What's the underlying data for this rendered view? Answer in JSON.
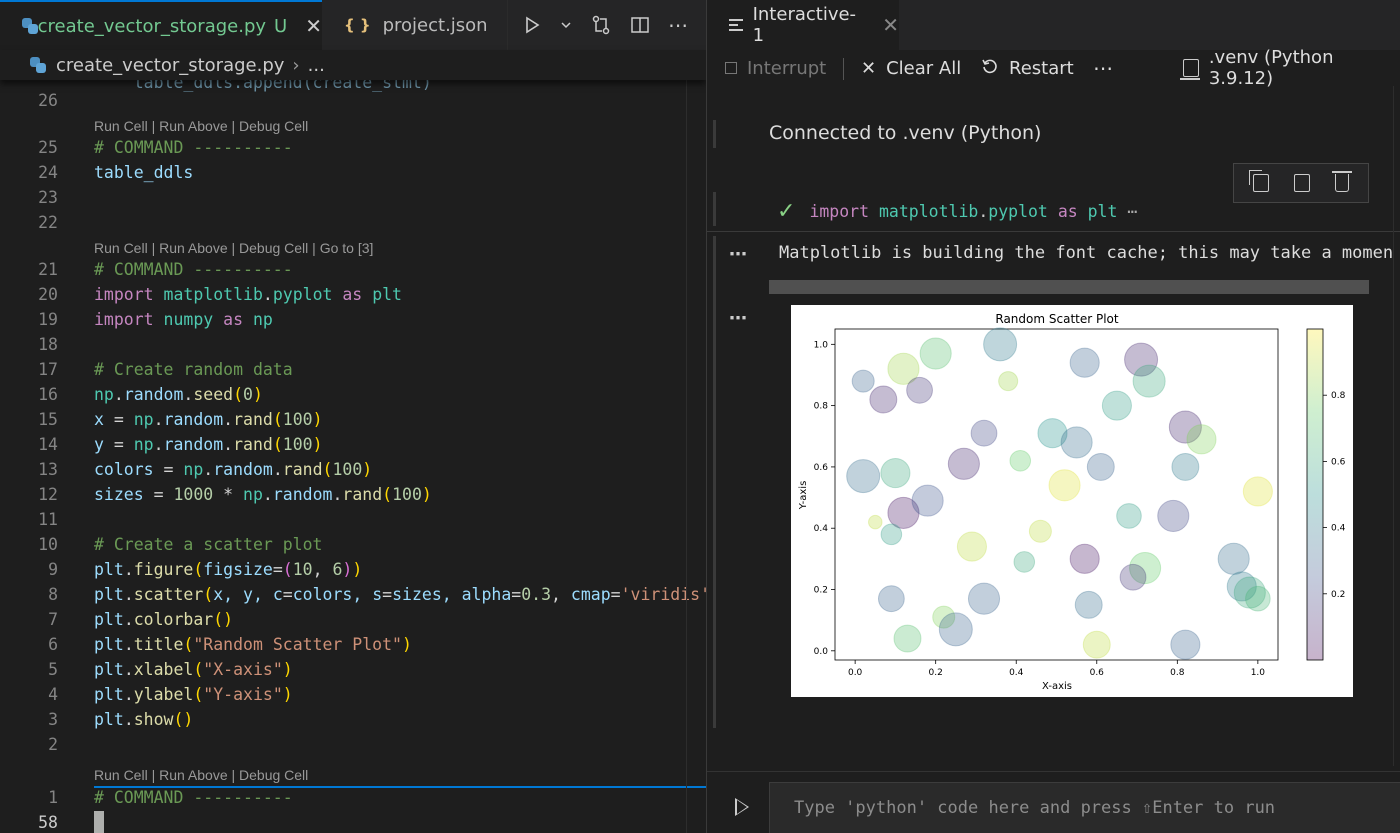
{
  "left_editor": {
    "tabs": [
      {
        "label": "create_vector_storage.py",
        "status": "U",
        "active": true
      },
      {
        "label": "project.json",
        "active": false
      }
    ],
    "breadcrumb": {
      "file": "create_vector_storage.py",
      "more": "..."
    },
    "codelens": {
      "cell_a": "Run Cell | Run Above | Debug Cell",
      "cell_b": "Run Cell | Run Above | Debug Cell | Go to [3]",
      "cell_c": "Run Cell | Run Above | Debug Cell"
    },
    "line_numbers": {
      "l26": "26",
      "l25": "25",
      "l24": "24",
      "l23": "23",
      "l22": "22",
      "l21": "21",
      "l20": "20",
      "l19": "19",
      "l18": "18",
      "l17": "17",
      "l16": "16",
      "l15": "15",
      "l14": "14",
      "l13": "13",
      "l12": "12",
      "l11": "11",
      "l10": "10",
      "l9": "9",
      "l8": "8",
      "l7": "7",
      "l6": "6",
      "l5": "5",
      "l4": "4",
      "l3": "3",
      "l2": "2",
      "l1": "1",
      "l58": "58"
    },
    "code": {
      "top_partial": "    table_ddls.append(create_stmt)",
      "c25": "# COMMAND ----------",
      "c24": "table_ddls",
      "c21": "# COMMAND ----------",
      "c17": "# Create random data",
      "c10": "# Create a scatter plot",
      "c1": "# COMMAND ----------",
      "c20_kw": "import",
      "c20_mod": "matplotlib",
      "c20_mod2": "pyplot",
      "c20_as": "as",
      "c20_alias": "plt",
      "c19_kw": "import",
      "c19_mod": "numpy",
      "c19_as": "as",
      "c19_alias": "np",
      "c16_a": "np",
      "c16_b": "random",
      "c16_c": "seed",
      "c16_n": "0",
      "c15_v": "x",
      "c15_a": "np",
      "c15_b": "random",
      "c15_c": "rand",
      "c15_n": "100",
      "c14_v": "y",
      "c14_a": "np",
      "c14_b": "random",
      "c14_c": "rand",
      "c14_n": "100",
      "c13_v": "colors",
      "c13_a": "np",
      "c13_b": "random",
      "c13_c": "rand",
      "c13_n": "100",
      "c12_v": "sizes",
      "c12_k": "1000",
      "c12_a": "np",
      "c12_b": "random",
      "c12_c": "rand",
      "c12_n": "100",
      "c9_a": "plt",
      "c9_f": "figure",
      "c9_p": "figsize",
      "c9_n1": "10",
      "c9_n2": "6",
      "c8_a": "plt",
      "c8_f": "scatter",
      "c8_args1": "x, y, ",
      "c8_p1": "c",
      "c8_args2": "colors, ",
      "c8_p2": "s",
      "c8_args3": "sizes, ",
      "c8_p3": "alpha",
      "c8_n": "0.3",
      "c8_p4": "cmap",
      "c8_s": "'viridis'",
      "c7_a": "plt",
      "c7_f": "colorbar",
      "c6_a": "plt",
      "c6_f": "title",
      "c6_s": "\"Random Scatter Plot\"",
      "c5_a": "plt",
      "c5_f": "xlabel",
      "c5_s": "\"X-axis\"",
      "c4_a": "plt",
      "c4_f": "ylabel",
      "c4_s": "\"Y-axis\"",
      "c3_a": "plt",
      "c3_f": "show"
    }
  },
  "interactive": {
    "tab_label": "Interactive-1",
    "toolbar": {
      "interrupt": "Interrupt",
      "clear_all": "Clear All",
      "restart": "Restart",
      "more": "⋯",
      "kernel": ".venv (Python 3.9.12)"
    },
    "connected_message": "Connected to .venv (Python)",
    "cell_input": {
      "kw": "import",
      "mod": "matplotlib",
      "mod2": "pyplot",
      "as": "as",
      "alias": "plt",
      "ellipsis": "⋯"
    },
    "output_text": "Matplotlib is building the font cache; this may take a momen",
    "input_placeholder": "Type 'python' code here and press ⇧Enter to run",
    "colors": {
      "accent": "#0078d4",
      "check": "#89d185"
    }
  },
  "chart_data": {
    "type": "scatter",
    "title": "Random Scatter Plot",
    "xlabel": "X-axis",
    "ylabel": "Y-axis",
    "xlim": [
      -0.05,
      1.05
    ],
    "ylim": [
      -0.03,
      1.05
    ],
    "xticks": [
      "0.0",
      "0.2",
      "0.4",
      "0.6",
      "0.8",
      "1.0"
    ],
    "yticks": [
      "0.0",
      "0.2",
      "0.4",
      "0.6",
      "0.8",
      "1.0"
    ],
    "colorbar": {
      "cmap": "viridis",
      "range": [
        0.0,
        1.0
      ],
      "ticks": [
        "0.2",
        "0.4",
        "0.6",
        "0.8"
      ]
    },
    "alpha": 0.3,
    "points": [
      {
        "x": 0.02,
        "y": 0.57,
        "c": 0.35,
        "s": 900
      },
      {
        "x": 0.02,
        "y": 0.88,
        "c": 0.3,
        "s": 400
      },
      {
        "x": 0.07,
        "y": 0.82,
        "c": 0.1,
        "s": 600
      },
      {
        "x": 0.05,
        "y": 0.42,
        "c": 0.9,
        "s": 150
      },
      {
        "x": 0.1,
        "y": 0.58,
        "c": 0.6,
        "s": 700
      },
      {
        "x": 0.12,
        "y": 0.92,
        "c": 0.85,
        "s": 800
      },
      {
        "x": 0.16,
        "y": 0.85,
        "c": 0.15,
        "s": 550
      },
      {
        "x": 0.12,
        "y": 0.45,
        "c": 0.05,
        "s": 800
      },
      {
        "x": 0.09,
        "y": 0.38,
        "c": 0.55,
        "s": 350
      },
      {
        "x": 0.09,
        "y": 0.17,
        "c": 0.3,
        "s": 550
      },
      {
        "x": 0.13,
        "y": 0.04,
        "c": 0.7,
        "s": 600
      },
      {
        "x": 0.18,
        "y": 0.49,
        "c": 0.25,
        "s": 800
      },
      {
        "x": 0.2,
        "y": 0.97,
        "c": 0.7,
        "s": 800
      },
      {
        "x": 0.22,
        "y": 0.11,
        "c": 0.8,
        "s": 400
      },
      {
        "x": 0.25,
        "y": 0.07,
        "c": 0.3,
        "s": 900
      },
      {
        "x": 0.27,
        "y": 0.61,
        "c": 0.1,
        "s": 800
      },
      {
        "x": 0.29,
        "y": 0.34,
        "c": 0.9,
        "s": 700
      },
      {
        "x": 0.32,
        "y": 0.71,
        "c": 0.2,
        "s": 550
      },
      {
        "x": 0.32,
        "y": 0.17,
        "c": 0.3,
        "s": 800
      },
      {
        "x": 0.36,
        "y": 1.0,
        "c": 0.4,
        "s": 900
      },
      {
        "x": 0.38,
        "y": 0.88,
        "c": 0.85,
        "s": 300
      },
      {
        "x": 0.41,
        "y": 0.62,
        "c": 0.75,
        "s": 350
      },
      {
        "x": 0.42,
        "y": 0.29,
        "c": 0.6,
        "s": 350
      },
      {
        "x": 0.46,
        "y": 0.39,
        "c": 0.9,
        "s": 400
      },
      {
        "x": 0.49,
        "y": 0.71,
        "c": 0.5,
        "s": 700
      },
      {
        "x": 0.52,
        "y": 0.54,
        "c": 0.95,
        "s": 800
      },
      {
        "x": 0.55,
        "y": 0.68,
        "c": 0.35,
        "s": 800
      },
      {
        "x": 0.57,
        "y": 0.94,
        "c": 0.3,
        "s": 700
      },
      {
        "x": 0.57,
        "y": 0.3,
        "c": 0.05,
        "s": 700
      },
      {
        "x": 0.58,
        "y": 0.15,
        "c": 0.35,
        "s": 600
      },
      {
        "x": 0.6,
        "y": 0.02,
        "c": 0.9,
        "s": 600
      },
      {
        "x": 0.61,
        "y": 0.6,
        "c": 0.3,
        "s": 600
      },
      {
        "x": 0.65,
        "y": 0.8,
        "c": 0.55,
        "s": 700
      },
      {
        "x": 0.68,
        "y": 0.44,
        "c": 0.55,
        "s": 500
      },
      {
        "x": 0.71,
        "y": 0.95,
        "c": 0.1,
        "s": 900
      },
      {
        "x": 0.72,
        "y": 0.27,
        "c": 0.75,
        "s": 800
      },
      {
        "x": 0.69,
        "y": 0.24,
        "c": 0.15,
        "s": 550
      },
      {
        "x": 0.73,
        "y": 0.88,
        "c": 0.6,
        "s": 850
      },
      {
        "x": 0.79,
        "y": 0.44,
        "c": 0.2,
        "s": 800
      },
      {
        "x": 0.82,
        "y": 0.6,
        "c": 0.4,
        "s": 600
      },
      {
        "x": 0.82,
        "y": 0.73,
        "c": 0.1,
        "s": 850
      },
      {
        "x": 0.86,
        "y": 0.69,
        "c": 0.8,
        "s": 700
      },
      {
        "x": 0.82,
        "y": 0.02,
        "c": 0.3,
        "s": 700
      },
      {
        "x": 0.94,
        "y": 0.3,
        "c": 0.35,
        "s": 800
      },
      {
        "x": 0.96,
        "y": 0.21,
        "c": 0.4,
        "s": 700
      },
      {
        "x": 0.98,
        "y": 0.19,
        "c": 0.6,
        "s": 800
      },
      {
        "x": 1.0,
        "y": 0.52,
        "c": 0.95,
        "s": 700
      },
      {
        "x": 1.0,
        "y": 0.17,
        "c": 0.65,
        "s": 500
      }
    ]
  }
}
